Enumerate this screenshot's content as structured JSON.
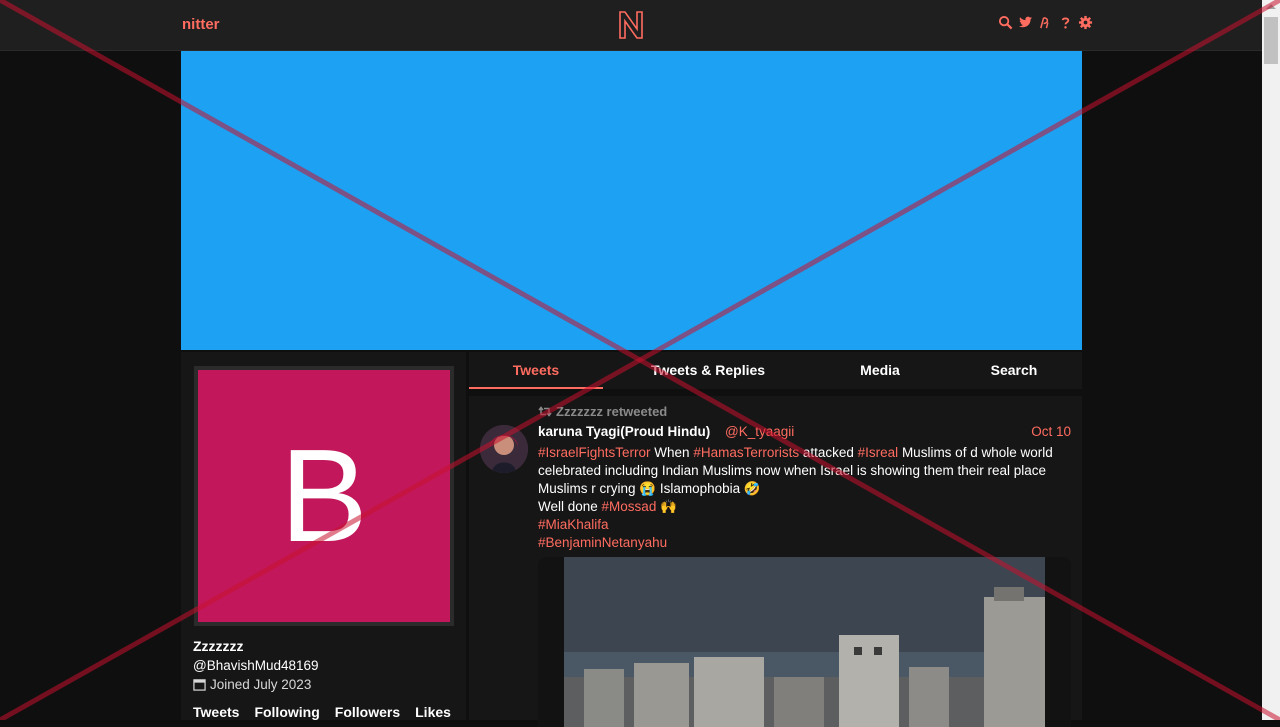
{
  "navbar": {
    "brand": "nitter",
    "logo_letter": "N",
    "icons": [
      "search-icon",
      "twitter-bird-icon",
      "rss-icon",
      "help-icon",
      "settings-gear-icon"
    ]
  },
  "profile": {
    "avatar_letter": "B",
    "avatar_color": "#c2185b",
    "banner_color": "#1da1f2",
    "fullname": "Zzzzzzz",
    "username": "@BhavishMud48169",
    "join_date": "Joined July 2023",
    "stats": [
      "Tweets",
      "Following",
      "Followers",
      "Likes"
    ]
  },
  "tabs": [
    {
      "label": "Tweets",
      "active": true
    },
    {
      "label": "Tweets & Replies",
      "active": false
    },
    {
      "label": "Media",
      "active": false
    },
    {
      "label": "Search",
      "active": false
    }
  ],
  "tweet": {
    "retweet_header": "Zzzzzzz retweeted",
    "author_name": "karuna Tyagi(Proud Hindu)",
    "author_handle": "@K_tyaagii",
    "date": "Oct 10",
    "body": {
      "tag_1": "#IsraelFightsTerror",
      "text_1": " When ",
      "tag_2": "#HamasTerrorists",
      "text_2": " attacked ",
      "tag_3": "#Isreal",
      "text_3": " Muslims of d whole world celebrated including Indian Muslims now when Israel is showing them their real place Muslims r crying 😭 Islamophobia 🤣",
      "text_4": "Well done ",
      "tag_4": "#Mossad",
      "text_5": " 🙌",
      "tag_5": "#MiaKhalifa",
      "tag_6": "#BenjaminNetanyahu"
    }
  },
  "colors": {
    "accent": "#ff6c60",
    "background": "#0f0f0f",
    "panel": "#161616",
    "navbar": "#1f1f1f"
  }
}
